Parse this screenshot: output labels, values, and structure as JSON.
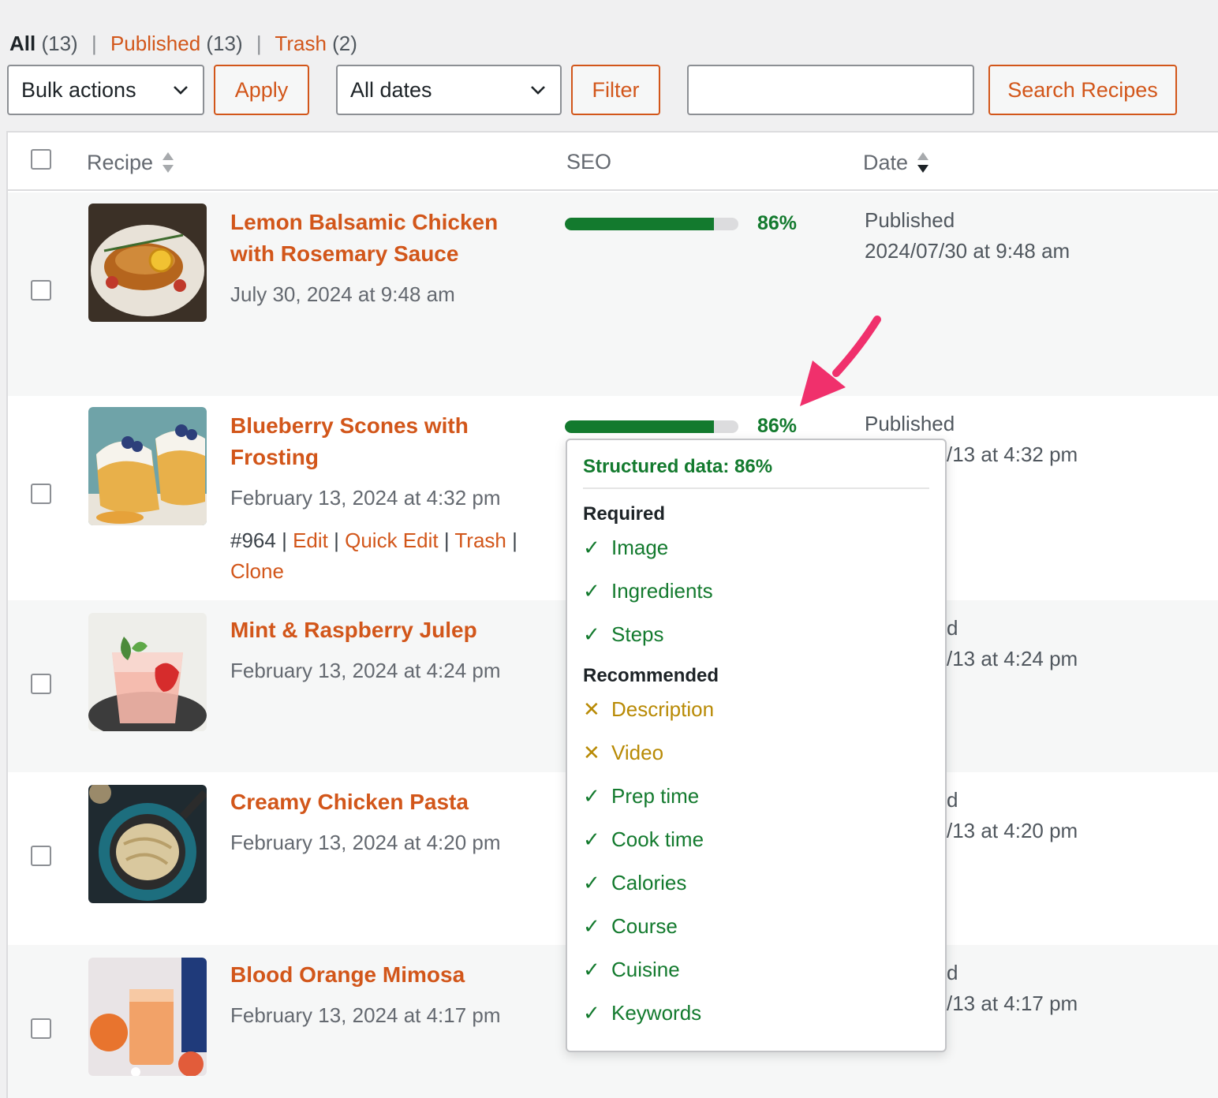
{
  "filters": {
    "all_label": "All",
    "all_count": "(13)",
    "published_label": "Published",
    "published_count": "(13)",
    "trash_label": "Trash",
    "trash_count": "(2)",
    "separator": "|"
  },
  "toolbar": {
    "bulk_actions": "Bulk actions",
    "apply": "Apply",
    "dates": "All dates",
    "filter": "Filter",
    "search_value": "",
    "search_button": "Search Recipes"
  },
  "columns": {
    "recipe": "Recipe",
    "seo": "SEO",
    "date": "Date"
  },
  "rows": [
    {
      "title": "Lemon Balsamic Chicken with Rosemary Sauce",
      "date": "July 30, 2024 at 9:48 am",
      "seo_pct_text": "86%",
      "seo_fraction": 0.86,
      "status": "Published",
      "pub_date": "2024/07/30 at 9:48 am"
    },
    {
      "title": "Blueberry Scones with Frosting",
      "date": "February 13, 2024 at 4:32 pm",
      "seo_pct_text": "86%",
      "seo_fraction": 0.86,
      "status": "Published",
      "pub_date": "/13 at 4:32 pm",
      "actions": {
        "id": "#964",
        "edit": "Edit",
        "quick_edit": "Quick Edit",
        "trash": "Trash",
        "clone": "Clone",
        "sep": "|"
      }
    },
    {
      "title": "Mint & Raspberry Julep",
      "date": "February 13, 2024 at 4:24 pm",
      "status": "d",
      "pub_date": "/13 at 4:24 pm"
    },
    {
      "title": "Creamy Chicken Pasta",
      "date": "February 13, 2024 at 4:20 pm",
      "status": "d",
      "pub_date": "/13 at 4:20 pm"
    },
    {
      "title": "Blood Orange Mimosa",
      "date": "February 13, 2024 at 4:17 pm",
      "status": "d",
      "pub_date": "/13 at 4:17 pm"
    }
  ],
  "popover": {
    "title": "Structured data: 86%",
    "required_label": "Required",
    "required": [
      {
        "label": "Image",
        "status": "ok"
      },
      {
        "label": "Ingredients",
        "status": "ok"
      },
      {
        "label": "Steps",
        "status": "ok"
      }
    ],
    "recommended_label": "Recommended",
    "recommended": [
      {
        "label": "Description",
        "status": "missing"
      },
      {
        "label": "Video",
        "status": "missing"
      },
      {
        "label": "Prep time",
        "status": "ok"
      },
      {
        "label": "Cook time",
        "status": "ok"
      },
      {
        "label": "Calories",
        "status": "ok"
      },
      {
        "label": "Course",
        "status": "ok"
      },
      {
        "label": "Cuisine",
        "status": "ok"
      },
      {
        "label": "Keywords",
        "status": "ok"
      }
    ],
    "ok_mark": "✓",
    "missing_mark": "✕"
  },
  "colors": {
    "accent": "#d2561a",
    "seo_green": "#137a2e",
    "warning": "#b88a05",
    "annotation_arrow": "#f0306c"
  }
}
